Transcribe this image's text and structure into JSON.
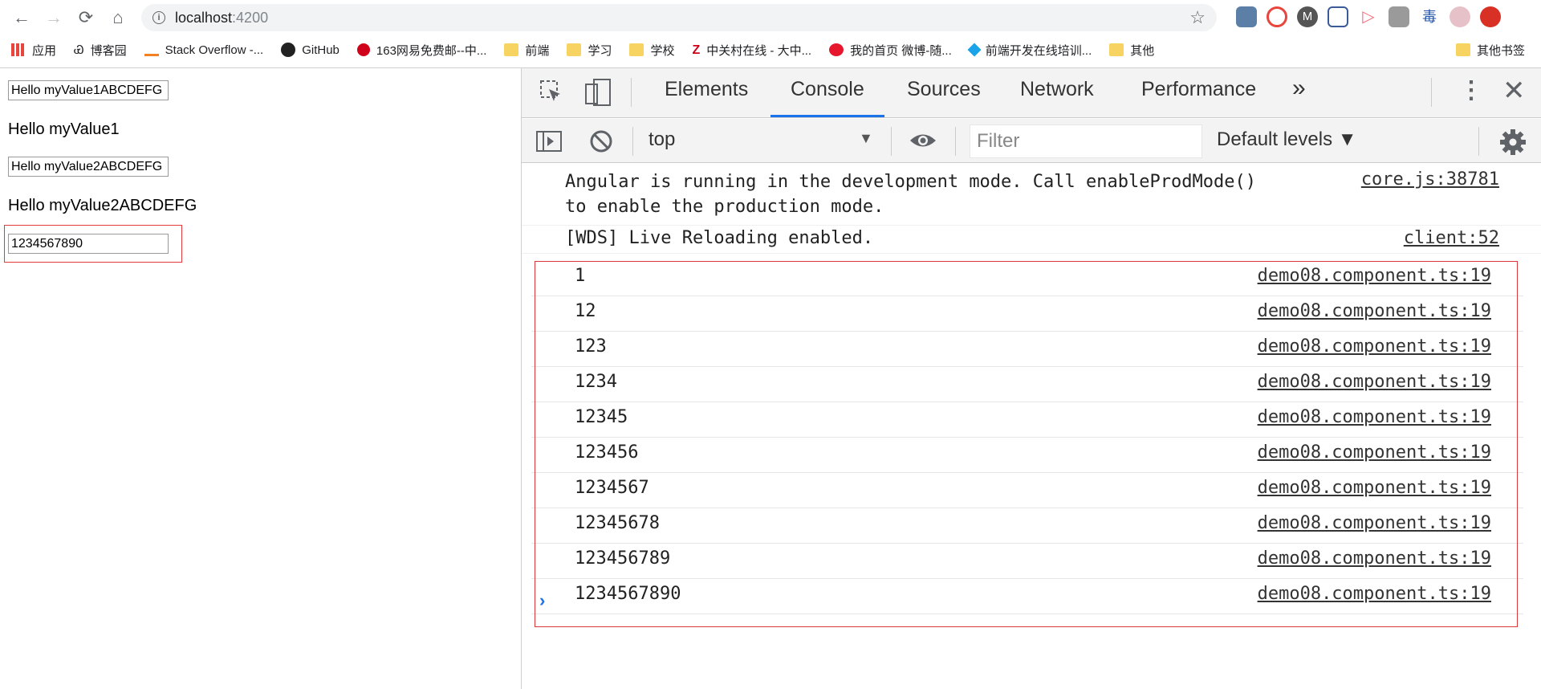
{
  "browser": {
    "url_host": "localhost",
    "url_port": ":4200",
    "bookmarks": [
      {
        "label": "应用",
        "icon": "apps-grid-icon"
      },
      {
        "label": "博客园",
        "icon": "cnblogs-icon"
      },
      {
        "label": "Stack Overflow -...",
        "icon": "stackoverflow-icon"
      },
      {
        "label": "GitHub",
        "icon": "github-icon"
      },
      {
        "label": "163网易免费邮--中...",
        "icon": "netease-icon"
      },
      {
        "label": "前端",
        "icon": "folder-icon"
      },
      {
        "label": "学习",
        "icon": "folder-icon"
      },
      {
        "label": "学校",
        "icon": "folder-icon"
      },
      {
        "label": "中关村在线 - 大中...",
        "icon": "zol-icon"
      },
      {
        "label": "我的首页 微博-随...",
        "icon": "weibo-icon"
      },
      {
        "label": "前端开发在线培训...",
        "icon": "course-icon"
      },
      {
        "label": "其他",
        "icon": "folder-icon"
      }
    ],
    "other_bookmarks": "其他书签"
  },
  "page": {
    "input1_value": "Hello myValue1ABCDEFG",
    "text1": "Hello myValue1",
    "input2_value": "Hello myValue2ABCDEFG",
    "text2": "Hello myValue2ABCDEFG",
    "input3_value": "1234567890"
  },
  "devtools": {
    "tabs": [
      "Elements",
      "Console",
      "Sources",
      "Network",
      "Performance"
    ],
    "active_tab": "Console",
    "more_tabs": "»",
    "context": "top",
    "filter_placeholder": "Filter",
    "levels": "Default levels ▼",
    "messages": [
      {
        "text": "Angular is running in the development mode. Call enableProdMode()\nto enable the production mode.",
        "source": "core.js:38781"
      },
      {
        "text": "[WDS] Live Reloading enabled.",
        "source": "client:52"
      }
    ],
    "logs": [
      {
        "text": "1",
        "source": "demo08.component.ts:19"
      },
      {
        "text": "12",
        "source": "demo08.component.ts:19"
      },
      {
        "text": "123",
        "source": "demo08.component.ts:19"
      },
      {
        "text": "1234",
        "source": "demo08.component.ts:19"
      },
      {
        "text": "12345",
        "source": "demo08.component.ts:19"
      },
      {
        "text": "123456",
        "source": "demo08.component.ts:19"
      },
      {
        "text": "1234567",
        "source": "demo08.component.ts:19"
      },
      {
        "text": "12345678",
        "source": "demo08.component.ts:19"
      },
      {
        "text": "123456789",
        "source": "demo08.component.ts:19"
      },
      {
        "text": "1234567890",
        "source": "demo08.component.ts:19"
      }
    ],
    "prompt_symbol": "›"
  }
}
